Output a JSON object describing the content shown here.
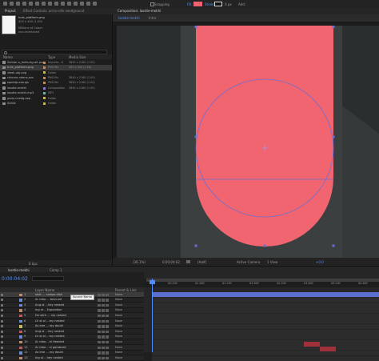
{
  "toolbar": {
    "snapping": "Snapping",
    "fill": "Fill:",
    "stroke": "Stroke:",
    "stroke_width": "0 px",
    "add": "Add:"
  },
  "project_panel": {
    "tab_title": "Project",
    "effects_tab": "Effect Controls: arnix-ville seedground",
    "info_name": "hule_platform.png",
    "info_line2": "400 x 400 (1.00)",
    "info_line3": "Millions of Colors",
    "info_line4": "non-interlaced",
    "columns": {
      "name": "Name",
      "type": "Type",
      "size": "Media Size"
    },
    "items": [
      {
        "name": "Solidar a_dutts-bg-alt.psd",
        "type": "Importe...G",
        "size": "3840 x 2160 (1.00)",
        "label_color": "#b98b6a"
      },
      {
        "name": "hule_platform.png",
        "type": "PNG file",
        "size": "400 x 400 (1.00)",
        "label_color": "#b98b6a",
        "selected": true
      },
      {
        "name": "sleek-obj.png",
        "type": "Folder",
        "size": "",
        "label_color": "#c2b95e"
      },
      {
        "name": "chbnne-ndens.avs",
        "type": "PNG file",
        "size": "3840 x 2160 (1.00)",
        "label_color": "#b98b6a"
      },
      {
        "name": "speedp-essngs",
        "type": "PNG file",
        "size": "3840 x 2160 (1.00)",
        "label_color": "#b98b6a"
      },
      {
        "name": "lasstie-mekhi",
        "type": "Composition",
        "size": "3840 x 2160 (1.00)",
        "label_color": "#8a7bd1"
      },
      {
        "name": "lasstie-mekhi.mp3",
        "type": "MP3",
        "size": "",
        "label_color": "#6fb0a8"
      },
      {
        "name": "polar-nvedg.aep",
        "type": "Folder",
        "size": "",
        "label_color": "#c2b95e"
      },
      {
        "name": "Solids",
        "type": "Folder",
        "size": "",
        "label_color": "#c2b95e"
      }
    ],
    "footer": "8 bpc"
  },
  "composition": {
    "tab": "Composition: lasstie-mekhi",
    "sub_tab_1": "lasstie-mekhi",
    "sub_tab_2": "Intro",
    "shape_color": "#f0656f",
    "viewer_bar": {
      "zoom": "(36.1%)",
      "time": "0;00;04;02",
      "res": "(Half)",
      "camera": "Active Camera",
      "views": "1 View",
      "exposure": "+0.0"
    }
  },
  "timeline": {
    "tab_1": "lasstie-mekhi",
    "tab_2": "Comp 1",
    "timecode": "0:00:04:02",
    "columns": {
      "source": "Layer Name",
      "parent": "Parent & Link"
    },
    "tooltip": "Source Name",
    "ruler_marks": [
      "00:15f",
      "01:00f",
      "01:15f",
      "02:00f",
      "02:15f",
      "03:00f",
      "03:15f",
      "04:00f"
    ],
    "layers": [
      {
        "num": "1",
        "name": "shot ... comps.dish",
        "parent": "None",
        "label_color": "#b98b6a",
        "selected": true
      },
      {
        "num": "2",
        "name": "Ar rebo ... bevo.alt",
        "parent": "None",
        "label_color": "#6a8ad1"
      },
      {
        "num": "3",
        "name": "Ang st .. hey nested",
        "parent": "None",
        "label_color": "#6a8ad1"
      },
      {
        "num": "4",
        "name": "Ing st .. Expolation",
        "parent": "None",
        "label_color": "#b98b6a"
      },
      {
        "num": "5",
        "name": "De stirk ... rey nested",
        "parent": "None",
        "label_color": "#c05a5a"
      },
      {
        "num": "6",
        "name": "LV st ol .. rey nested",
        "parent": "None",
        "label_color": "#6a8ad1"
      },
      {
        "num": "7",
        "name": "As lme ... roy dould",
        "parent": "None",
        "label_color": "#c2b95e"
      },
      {
        "num": "8",
        "name": "Ang st .. hey nested",
        "parent": "None",
        "label_color": "#c05a5a"
      },
      {
        "num": "9",
        "name": "LV st ol .. rey nested",
        "parent": "None",
        "label_color": "#6a8ad1"
      },
      {
        "num": "10",
        "name": "Ar rebo .. el Headed",
        "parent": "None",
        "label_color": "#b98b6a"
      },
      {
        "num": "11",
        "name": "Ar rebo .. sl garobced",
        "parent": "None",
        "label_color": "#c05a5a"
      },
      {
        "num": "12",
        "name": "As lme ... roy dould",
        "parent": "None",
        "label_color": "#6a8ad1"
      },
      {
        "num": "13",
        "name": "Ing st .. hey nested",
        "parent": "None",
        "label_color": "#b98b6a"
      }
    ]
  }
}
